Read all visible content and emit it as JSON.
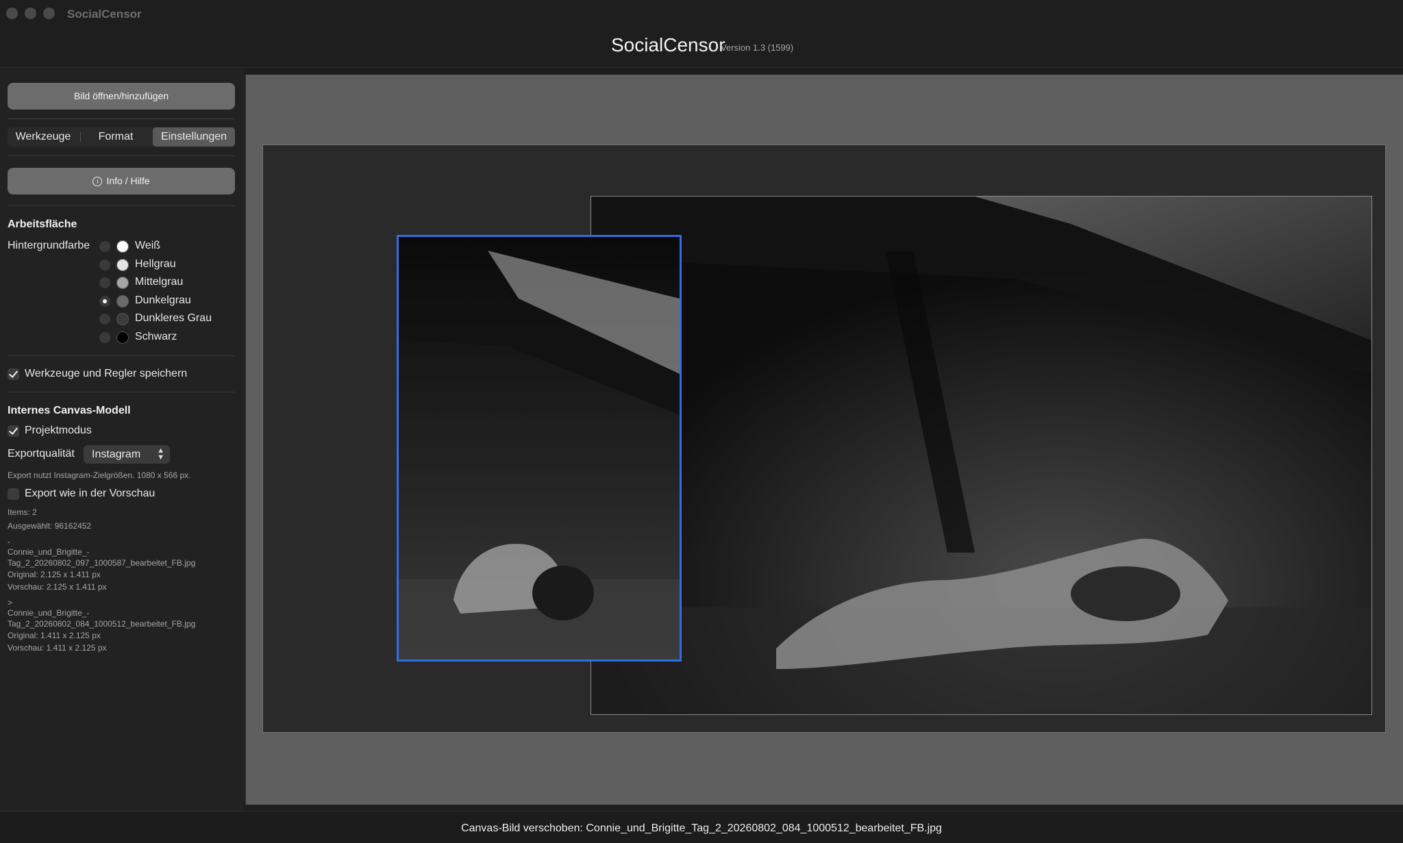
{
  "window": {
    "title": "SocialCensor"
  },
  "header": {
    "app_name": "SocialCensor",
    "version": "Version 1.3 (1599)"
  },
  "sidebar": {
    "open_button": "Bild öffnen/hinzufügen",
    "tabs": [
      {
        "label": "Werkzeuge"
      },
      {
        "label": "Format"
      },
      {
        "label": "Einstellungen"
      }
    ],
    "info_button": "Info / Hilfe",
    "workspace": {
      "title": "Arbeitsfläche",
      "bg_label": "Hintergrundfarbe",
      "colors": [
        {
          "label": "Weiß",
          "swatch": "#ffffff",
          "selected": false
        },
        {
          "label": "Hellgrau",
          "swatch": "#e4e4e4",
          "selected": false
        },
        {
          "label": "Mittelgrau",
          "swatch": "#a6a6a6",
          "selected": false
        },
        {
          "label": "Dunkelgrau",
          "swatch": "#6a6a6a",
          "selected": true
        },
        {
          "label": "Dunkleres Grau",
          "swatch": "#3c3c3c",
          "selected": false
        },
        {
          "label": "Schwarz",
          "swatch": "#000000",
          "selected": false
        }
      ]
    },
    "save_tools": "Werkzeuge und Regler speichern",
    "canvas_model": {
      "title": "Internes Canvas-Modell",
      "project_mode": "Projektmodus",
      "export_quality_label": "Exportqualität",
      "export_quality_value": "Instagram",
      "export_note": "Export nutzt Instagram-Zielgrößen. 1080 x 566 px.",
      "export_as_preview": "Export wie in der Vorschau"
    },
    "info": {
      "items": "Items: 2",
      "selected": "Ausgewählt: 96162452",
      "entries": [
        {
          "marker": "-",
          "name1": "Connie_und_Brigitte_-",
          "name2": "Tag_2_20260802_097_1000587_bearbeitet_FB.jpg",
          "original": "Original: 2.125 x 1.411 px",
          "preview": "Vorschau: 2.125 x 1.411 px"
        },
        {
          "marker": ">",
          "name1": "Connie_und_Brigitte_-",
          "name2": "Tag_2_20260802_084_1000512_bearbeitet_FB.jpg",
          "original": "Original: 1.411 x 2.125 px",
          "preview": "Vorschau: 1.411 x 2.125 px"
        }
      ]
    }
  },
  "status": {
    "text": "Canvas-Bild verschoben: Connie_und_Brigitte_Tag_2_20260802_084_1000512_bearbeitet_FB.jpg"
  },
  "colors": {
    "accent_selection": "#2f6fe4",
    "button_bg": "#6c6c6c"
  }
}
